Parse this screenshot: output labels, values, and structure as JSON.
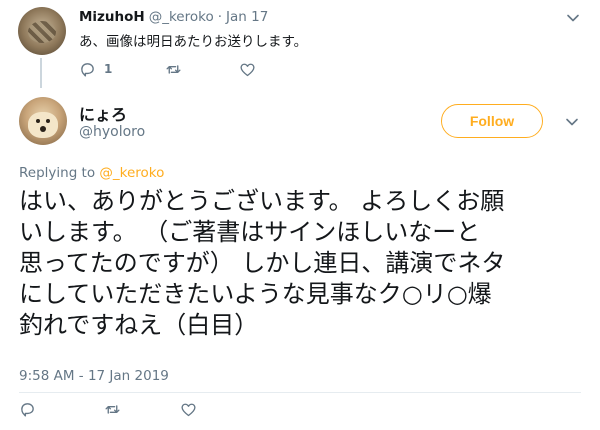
{
  "parent_tweet": {
    "author_name": "MizuhoH",
    "author_handle": "@_keroko",
    "separator": "·",
    "date": "Jan 17",
    "text": "あ、画像は明日あたりお送りします。",
    "reply_count": "1",
    "icons": [
      "reply-icon",
      "retweet-icon",
      "like-icon",
      "chevron-down-icon"
    ]
  },
  "main_tweet": {
    "author_name": "にょろ",
    "author_handle": "@hyoloro",
    "follow_label": "Follow",
    "replying_prefix": "Replying to",
    "replying_to": "@_keroko",
    "text_lines": [
      "はい、ありがとうございます。 よろしくお願",
      "いします。 （ご著書はサインほしいなーと",
      "思ってたのですが） しかし連日、講演でネタ",
      "にしていただきたいような見事なク○リ○爆",
      "釣れですねえ（白目）"
    ],
    "timestamp": "9:58 AM - 17 Jan 2019",
    "icons": [
      "reply-icon",
      "retweet-icon",
      "like-icon",
      "chevron-down-icon"
    ]
  },
  "colors": {
    "accent": "#ffad1f",
    "text_primary": "#14171a",
    "text_secondary": "#657786",
    "divider": "#e6ecf0"
  }
}
